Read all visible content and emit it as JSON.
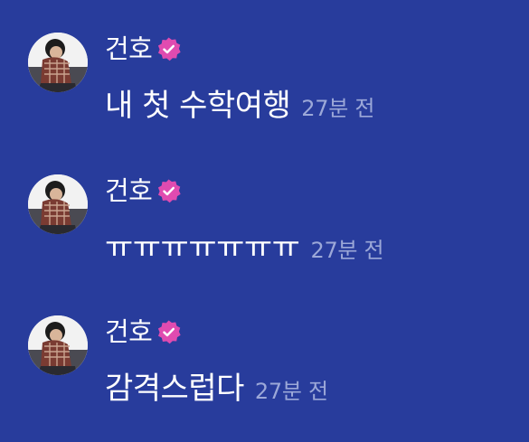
{
  "messages": [
    {
      "author": "건호",
      "verified_icon": "verified-badge-icon",
      "text": "내 첫 수학여행",
      "time": "27분 전"
    },
    {
      "author": "건호",
      "verified_icon": "verified-badge-icon",
      "text": "ㅠㅠㅠㅠㅠㅠㅠ",
      "time": "27분 전"
    },
    {
      "author": "건호",
      "verified_icon": "verified-badge-icon",
      "text": "감격스럽다",
      "time": "27분 전"
    }
  ],
  "colors": {
    "background": "#283c9c",
    "text": "#ffffff",
    "timestamp": "#9ca8d8",
    "badge": "#e04bb0"
  }
}
